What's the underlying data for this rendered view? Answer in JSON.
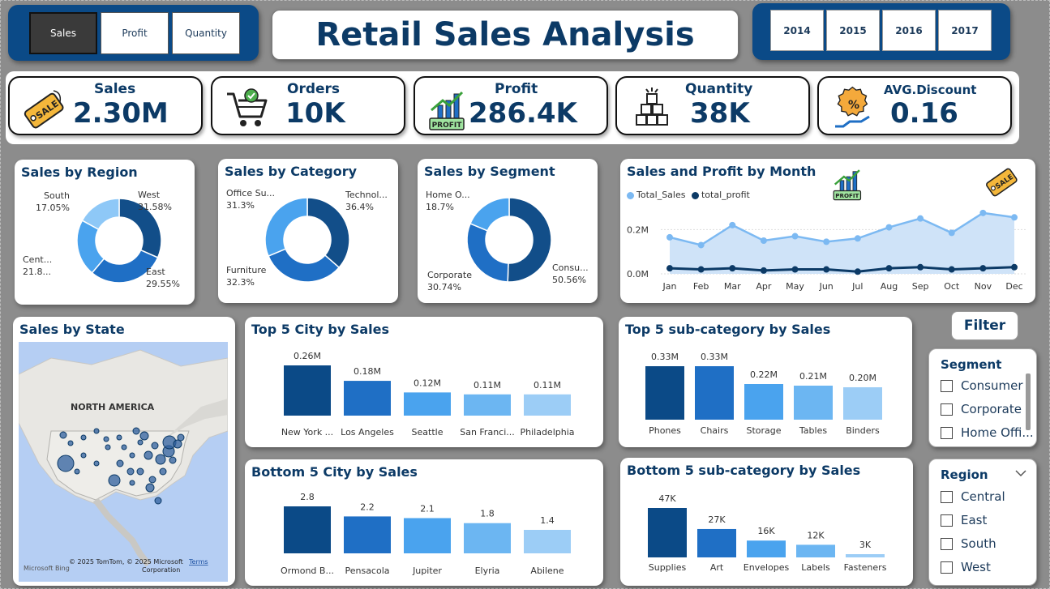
{
  "metric_buttons": [
    "Sales",
    "Profit",
    "Quantity"
  ],
  "title": "Retail Sales Analysis",
  "years": [
    "2014",
    "2015",
    "2016",
    "2017"
  ],
  "kpis": [
    {
      "label": "Sales",
      "value": "2.30M",
      "icon": "sale-tag-icon"
    },
    {
      "label": "Orders",
      "value": "10K",
      "icon": "shopping-cart-icon"
    },
    {
      "label": "Profit",
      "value": "286.4K",
      "icon": "profit-chart-icon"
    },
    {
      "label": "Quantity",
      "value": "38K",
      "icon": "boxes-icon"
    },
    {
      "label": "AVG.Discount",
      "value": "0.16",
      "icon": "discount-hand-icon"
    }
  ],
  "profit_badge": "PROFIT",
  "sale_tag": "SALE",
  "map": {
    "title": "Sales by State",
    "region_label": "NORTH AMERICA",
    "attribution_1": "© 2025 TomTom, © 2025 Microsoft",
    "attribution_2": "Corporation",
    "terms": "Terms",
    "logo": "Microsoft Bing"
  },
  "filter": {
    "heading": "Filter",
    "segment_title": "Segment",
    "segments": [
      "Consumer",
      "Corporate",
      "Home Offi..."
    ],
    "region_title": "Region",
    "regions": [
      "Central",
      "East",
      "South",
      "West"
    ]
  },
  "chart_data": [
    {
      "type": "pie",
      "title": "Sales by Region",
      "categories": [
        "West",
        "East",
        "Central",
        "South"
      ],
      "values": [
        31.58,
        29.55,
        21.82,
        17.05
      ],
      "display_labels": [
        [
          "West",
          "31.58%"
        ],
        [
          "East",
          "29.55%"
        ],
        [
          "Cent...",
          "21.8..."
        ],
        [
          "South",
          "17.05%"
        ]
      ],
      "colors": [
        "#124e89",
        "#1f6fc5",
        "#4aa3ee",
        "#8ec8f7"
      ]
    },
    {
      "type": "pie",
      "title": "Sales by Category",
      "categories": [
        "Technology",
        "Furniture",
        "Office Supplies"
      ],
      "values": [
        36.4,
        32.3,
        31.3
      ],
      "display_labels": [
        [
          "Technol...",
          "36.4%"
        ],
        [
          "Furniture",
          "32.3%"
        ],
        [
          "Office Su...",
          "31.3%"
        ]
      ],
      "colors": [
        "#124e89",
        "#1f6fc5",
        "#4aa3ee"
      ]
    },
    {
      "type": "pie",
      "title": "Sales by Segment",
      "categories": [
        "Consumer",
        "Corporate",
        "Home Office"
      ],
      "values": [
        50.56,
        30.74,
        18.7
      ],
      "display_labels": [
        [
          "Consu...",
          "50.56%"
        ],
        [
          "Corporate",
          "30.74%"
        ],
        [
          "Home O...",
          "18.7%"
        ]
      ],
      "colors": [
        "#124e89",
        "#1f6fc5",
        "#4aa3ee"
      ]
    },
    {
      "type": "area",
      "title": "Sales and Profit by Month",
      "x": [
        "Jan",
        "Feb",
        "Mar",
        "Apr",
        "May",
        "Jun",
        "Jul",
        "Aug",
        "Sep",
        "Oct",
        "Nov",
        "Dec"
      ],
      "series": [
        {
          "name": "Total_Sales",
          "color": "#7cb9f2",
          "values": [
            0.165,
            0.13,
            0.22,
            0.15,
            0.17,
            0.145,
            0.16,
            0.21,
            0.25,
            0.185,
            0.275,
            0.255
          ]
        },
        {
          "name": "total_profit",
          "color": "#0c3a66",
          "values": [
            0.025,
            0.02,
            0.025,
            0.015,
            0.02,
            0.02,
            0.01,
            0.025,
            0.03,
            0.02,
            0.025,
            0.03
          ]
        }
      ],
      "y_ticks": [
        "0.0M",
        "0.2M"
      ],
      "ylim": [
        0,
        0.3
      ]
    },
    {
      "type": "bar",
      "title": "Top 5 City by Sales",
      "categories": [
        "New York ...",
        "Los Angeles",
        "Seattle",
        "San Franci...",
        "Philadelphia"
      ],
      "values": [
        0.26,
        0.18,
        0.12,
        0.11,
        0.11
      ],
      "value_labels": [
        "0.26M",
        "0.18M",
        "0.12M",
        "0.11M",
        "0.11M"
      ],
      "colors": [
        "#0b4a87",
        "#1f6fc5",
        "#4aa3ee",
        "#6cb6f2",
        "#9ccdf6"
      ]
    },
    {
      "type": "bar",
      "title": "Top 5 sub-category by Sales",
      "categories": [
        "Phones",
        "Chairs",
        "Storage",
        "Tables",
        "Binders"
      ],
      "values": [
        0.33,
        0.33,
        0.22,
        0.21,
        0.2
      ],
      "value_labels": [
        "0.33M",
        "0.33M",
        "0.22M",
        "0.21M",
        "0.20M"
      ],
      "colors": [
        "#0b4a87",
        "#1f6fc5",
        "#4aa3ee",
        "#6cb6f2",
        "#9ccdf6"
      ]
    },
    {
      "type": "bar",
      "title": "Bottom 5 City by Sales",
      "categories": [
        "Ormond B...",
        "Pensacola",
        "Jupiter",
        "Elyria",
        "Abilene"
      ],
      "values": [
        2.8,
        2.2,
        2.1,
        1.8,
        1.4
      ],
      "value_labels": [
        "2.8",
        "2.2",
        "2.1",
        "1.8",
        "1.4"
      ],
      "colors": [
        "#0b4a87",
        "#1f6fc5",
        "#4aa3ee",
        "#6cb6f2",
        "#9ccdf6"
      ]
    },
    {
      "type": "bar",
      "title": "Bottom 5 sub-category by Sales",
      "categories": [
        "Supplies",
        "Art",
        "Envelopes",
        "Labels",
        "Fasteners"
      ],
      "values": [
        47,
        27,
        16,
        12,
        3
      ],
      "value_labels": [
        "47K",
        "27K",
        "16K",
        "12K",
        "3K"
      ],
      "colors": [
        "#0b4a87",
        "#1f6fc5",
        "#4aa3ee",
        "#6cb6f2",
        "#9ccdf6"
      ]
    }
  ]
}
